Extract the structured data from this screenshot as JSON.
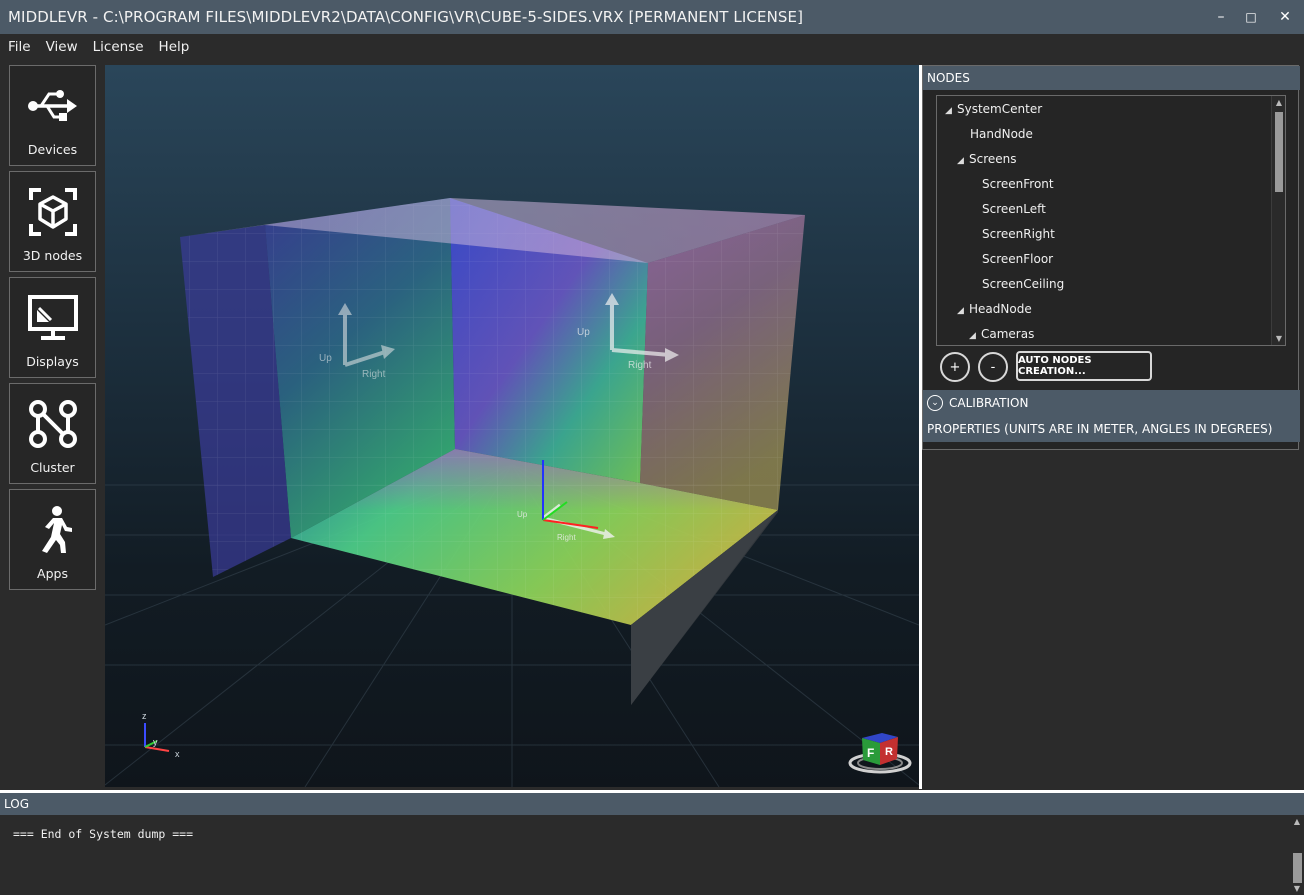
{
  "window": {
    "title": "MIDDLEVR - C:\\PROGRAM FILES\\MIDDLEVR2\\DATA\\CONFIG\\VR\\CUBE-5-SIDES.VRX [PERMANENT LICENSE]",
    "minimize": "–",
    "maximize": "□",
    "close": "✕"
  },
  "menu": [
    "File",
    "View",
    "License",
    "Help"
  ],
  "toolbar": [
    {
      "label": "Devices",
      "icon": "usb-icon"
    },
    {
      "label": "3D nodes",
      "icon": "cube-icon"
    },
    {
      "label": "Displays",
      "icon": "monitor-icon"
    },
    {
      "label": "Cluster",
      "icon": "cluster-icon"
    },
    {
      "label": "Apps",
      "icon": "walking-person-icon"
    }
  ],
  "viewport": {
    "screen_labels": {
      "up": "Up",
      "right": "Right"
    },
    "axis_gizmo": {
      "z": "z",
      "y": "y",
      "x": "x"
    },
    "view_cube": {
      "front": "F",
      "right": "R"
    }
  },
  "nodes_panel": {
    "header": "NODES",
    "tree": [
      {
        "label": "SystemCenter",
        "expanded": true
      },
      {
        "label": "HandNode",
        "expanded": null
      },
      {
        "label": "Screens",
        "expanded": true
      },
      {
        "label": "ScreenFront",
        "expanded": null
      },
      {
        "label": "ScreenLeft",
        "expanded": null
      },
      {
        "label": "ScreenRight",
        "expanded": null
      },
      {
        "label": "ScreenFloor",
        "expanded": null
      },
      {
        "label": "ScreenCeiling",
        "expanded": null
      },
      {
        "label": "HeadNode",
        "expanded": true
      },
      {
        "label": "Cameras",
        "expanded": true
      }
    ],
    "add_button": "+",
    "remove_button": "-",
    "auto_button": "AUTO NODES CREATION..."
  },
  "calibration": {
    "label": "CALIBRATION",
    "icon": "chevron-down-circle-icon"
  },
  "properties": {
    "label": "PROPERTIES (UNITS ARE IN METER, ANGLES IN DEGREES)"
  },
  "log": {
    "header": "LOG",
    "lines": [
      "=== End of System dump ==="
    ]
  },
  "colors": {
    "header_bg": "#4c5a67",
    "app_bg": "#2b2b2b",
    "separator": "#ffffff"
  }
}
